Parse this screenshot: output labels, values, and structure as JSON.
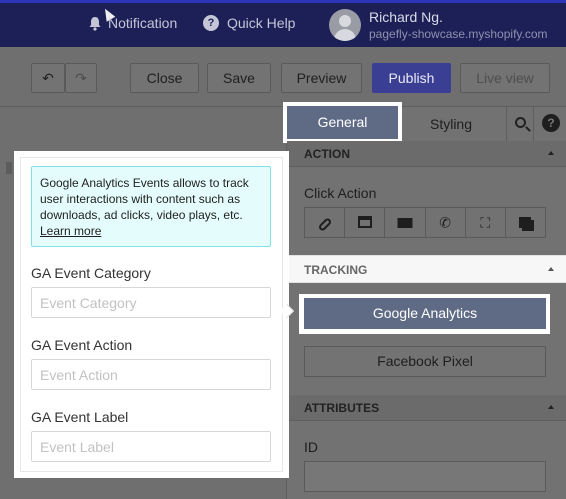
{
  "topbar": {
    "notification_label": "Notification",
    "help_label": "Quick Help",
    "user_name": "Richard Ng.",
    "store_domain": "pagefly-showcase.myshopify.com"
  },
  "toolbar": {
    "undo_icon": "↶",
    "redo_icon": "↷",
    "close_label": "Close",
    "save_label": "Save",
    "preview_label": "Preview",
    "publish_label": "Publish",
    "live_view_label": "Live view"
  },
  "panel": {
    "tabs": [
      {
        "label": "General",
        "active": true
      },
      {
        "label": "Styling",
        "active": false
      }
    ],
    "help_icon": "?",
    "action_section": {
      "title": "ACTION",
      "click_action_label": "Click Action",
      "icons": [
        "link-icon",
        "template-icon",
        "mail-icon",
        "phone-icon",
        "fullscreen-icon",
        "copy-icon"
      ]
    },
    "tracking_section": {
      "title": "TRACKING",
      "options": [
        {
          "label": "Google Analytics",
          "active": true
        },
        {
          "label": "Facebook Pixel",
          "active": false
        }
      ]
    },
    "attributes_section": {
      "title": "ATTRIBUTES",
      "id_label": "ID"
    }
  },
  "popover": {
    "info_text": "Google Analytics Events allows to track user interactions with content such as downloads, ad clicks, video plays, etc.",
    "learn_more": "Learn more",
    "fields": [
      {
        "label": "GA Event Category",
        "placeholder": "Event Category",
        "value": ""
      },
      {
        "label": "GA Event Action",
        "placeholder": "Event Action",
        "value": ""
      },
      {
        "label": "GA Event Label",
        "placeholder": "Event Label",
        "value": ""
      }
    ]
  },
  "colors": {
    "topbar_bg": "#1c2056",
    "publish_bg": "#3b3f93",
    "active_tab_bg": "#5f6b85",
    "info_bg": "#e5fcfd",
    "info_border": "#7fe0e5"
  }
}
